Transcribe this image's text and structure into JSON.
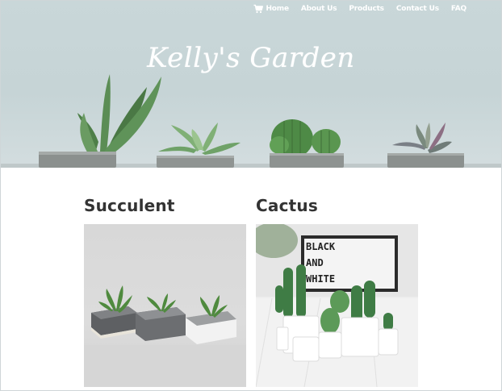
{
  "nav": {
    "items": [
      "Home",
      "About Us",
      "Products",
      "Contact Us",
      "FAQ"
    ],
    "cart_icon": "cart-icon"
  },
  "hero": {
    "title": "Kelly's Garden"
  },
  "categories": [
    {
      "label": "Succulent"
    },
    {
      "label": "Cactus"
    }
  ],
  "photo_board_text": [
    "BLACK",
    "AND",
    "WHITE"
  ],
  "colors": {
    "hero_sky": "#c9d7d9",
    "heading_text": "#333333",
    "plant_green": "#4f7a4c"
  }
}
